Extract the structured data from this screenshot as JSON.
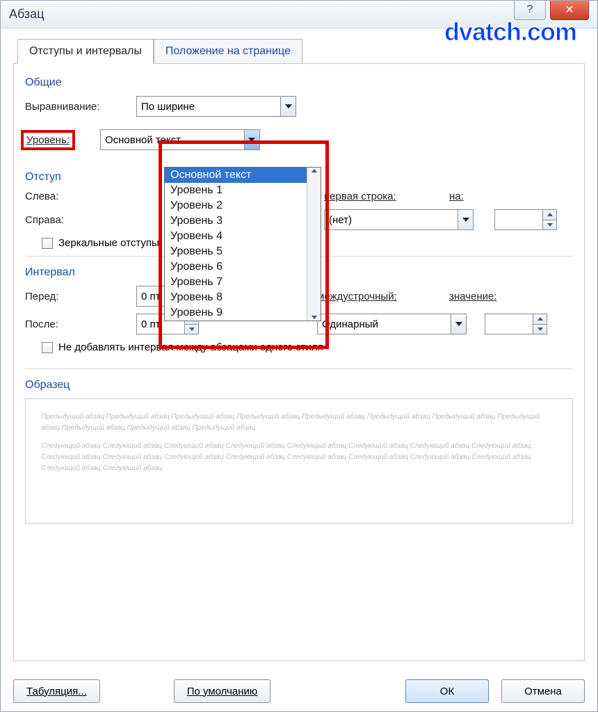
{
  "window": {
    "title": "Абзац"
  },
  "watermark": "dvatch.com",
  "tabs": {
    "t1": "Отступы и интервалы",
    "t2": "Положение на странице"
  },
  "general": {
    "group": "Общие",
    "align_label": "Выравнивание:",
    "align_value": "По ширине",
    "level_label": "Уровень:",
    "level_value": "Основной текст",
    "level_options": [
      "Основной текст",
      "Уровень 1",
      "Уровень 2",
      "Уровень 3",
      "Уровень 4",
      "Уровень 5",
      "Уровень 6",
      "Уровень 7",
      "Уровень 8",
      "Уровень 9"
    ]
  },
  "indent": {
    "group": "Отступ",
    "left_label": "Слева:",
    "right_label": "Справа:",
    "firstline_label": "первая строка:",
    "firstline_value": "(нет)",
    "by_label": "на:",
    "mirror_label": "Зеркальные отступы"
  },
  "spacing": {
    "group": "Интервал",
    "before_label": "Перед:",
    "before_value": "0 пт",
    "after_label": "После:",
    "after_value": "0 пт",
    "line_label": "междустрочный:",
    "line_value": "Одинарный",
    "value_label": "значение:",
    "nospace_label": "Не добавлять интервал между абзацами одного стиля"
  },
  "preview": {
    "group": "Образец",
    "prev_line": "Предыдущий абзац Предыдущий абзац Предыдущий абзац Предыдущий абзац Предыдущий абзац Предыдущий абзац Предыдущий абзац Предыдущий абзац Предыдущий абзац Предыдущий абзац Предыдущий абзац",
    "next_line": "Следующий абзац Следующий абзац Следующий абзац Следующий абзац Следующий абзац Следующий абзац Следующий абзац Следующий абзац Следующий абзац Следующий абзац Следующий абзац Следующий абзац Следующий абзац Следующий абзац Следующий абзац Следующий абзац Следующий абзац Следующий абзац"
  },
  "buttons": {
    "tabs": "Табуляция...",
    "default": "По умолчанию",
    "ok": "ОК",
    "cancel": "Отмена"
  }
}
